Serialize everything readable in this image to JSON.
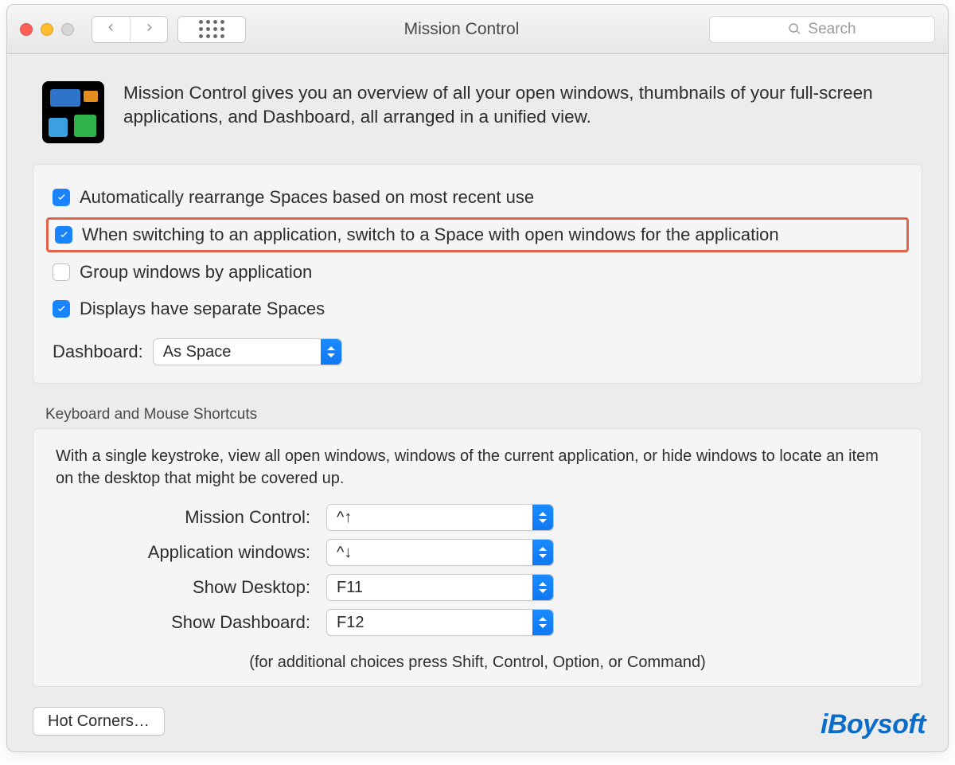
{
  "toolbar": {
    "title": "Mission Control",
    "search_placeholder": "Search"
  },
  "header": {
    "description": "Mission Control gives you an overview of all your open windows, thumbnails of your full-screen applications, and Dashboard, all arranged in a unified view."
  },
  "options": {
    "auto_rearrange": {
      "checked": true,
      "label": "Automatically rearrange Spaces based on most recent use"
    },
    "switch_space": {
      "checked": true,
      "label": "When switching to an application, switch to a Space with open windows for the application",
      "highlighted": true
    },
    "group_windows": {
      "checked": false,
      "label": "Group windows by application"
    },
    "separate_spaces": {
      "checked": true,
      "label": "Displays have separate Spaces"
    },
    "dashboard_label": "Dashboard:",
    "dashboard_value": "As Space"
  },
  "shortcuts_section_title": "Keyboard and Mouse Shortcuts",
  "shortcuts": {
    "intro": "With a single keystroke, view all open windows, windows of the current application, or hide windows to locate an item on the desktop that might be covered up.",
    "rows": [
      {
        "label": "Mission Control:",
        "value": "^↑"
      },
      {
        "label": "Application windows:",
        "value": "^↓"
      },
      {
        "label": "Show Desktop:",
        "value": "F11"
      },
      {
        "label": "Show Dashboard:",
        "value": "F12"
      }
    ],
    "hint": "(for additional choices press Shift, Control, Option, or Command)"
  },
  "footer": {
    "hot_corners": "Hot Corners…"
  },
  "watermark": "iBoysoft"
}
